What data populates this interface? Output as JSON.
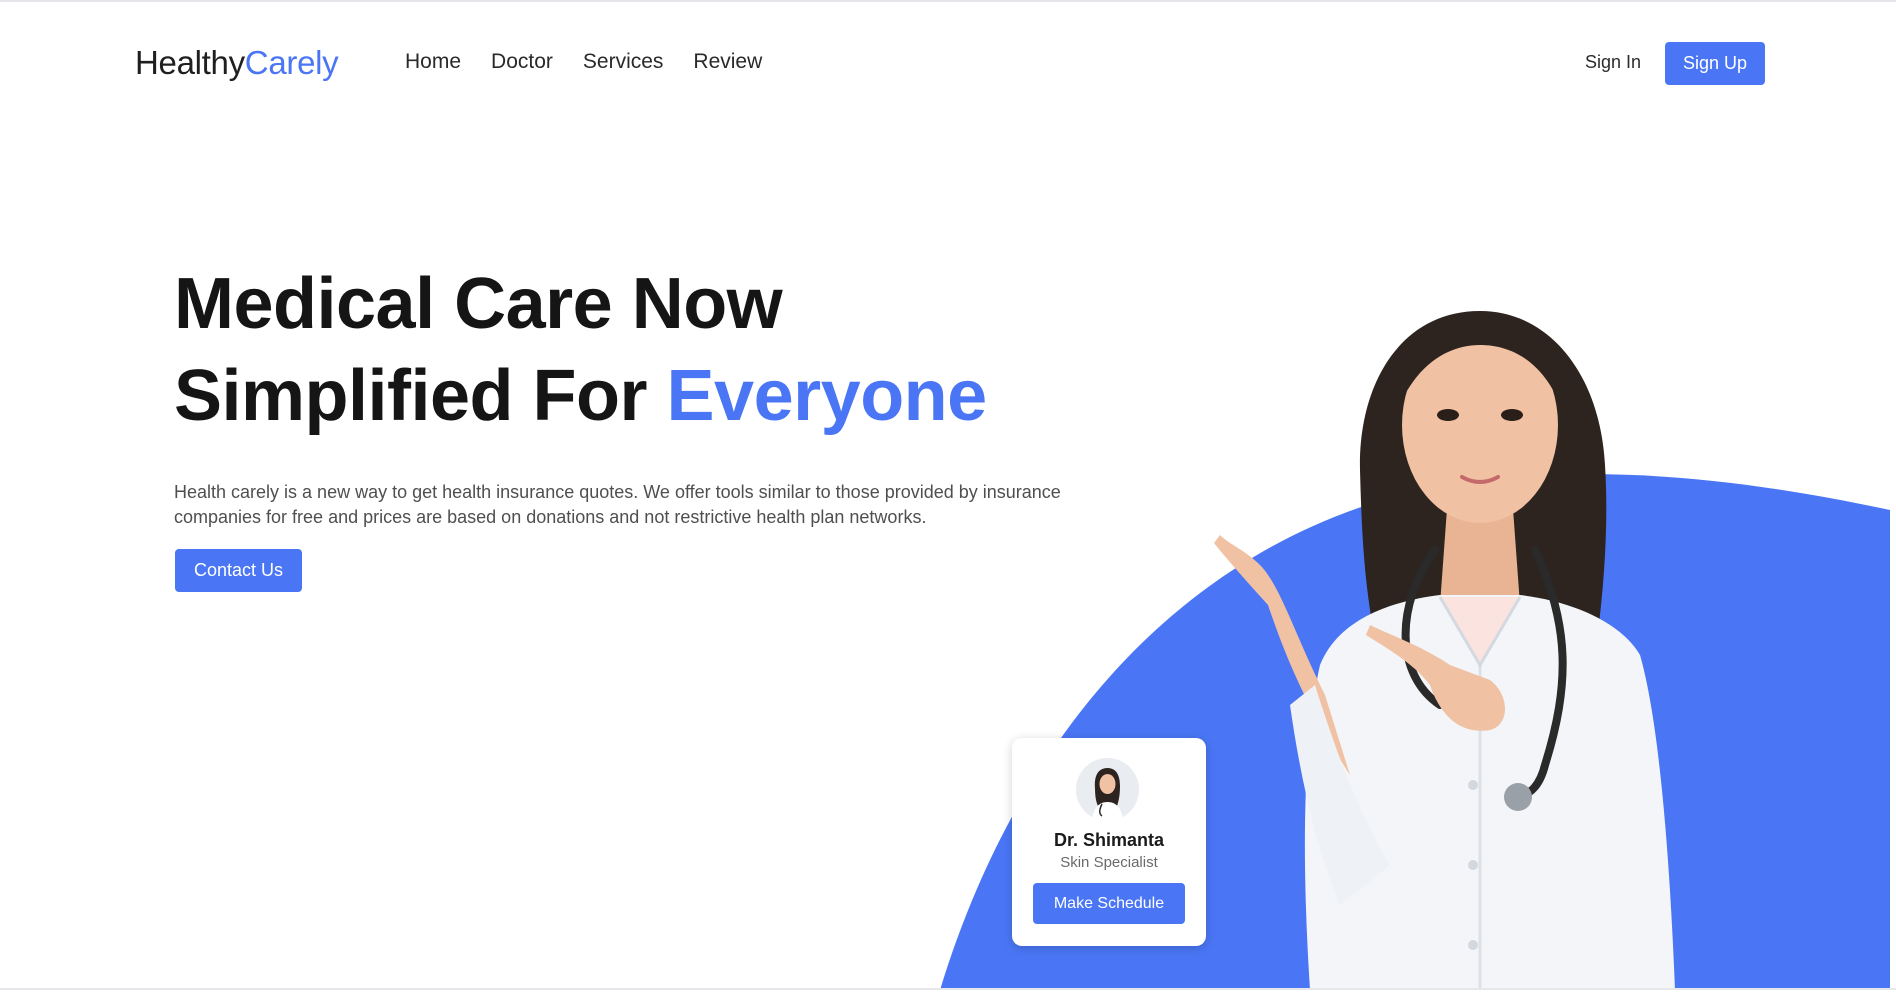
{
  "brand": {
    "name_part1": "Healthy",
    "name_part2": "Carely"
  },
  "nav": {
    "links": [
      "Home",
      "Doctor",
      "Services",
      "Review"
    ],
    "sign_in": "Sign In",
    "sign_up": "Sign Up"
  },
  "hero": {
    "title_line1": "Medical Care Now",
    "title_line2_prefix": "Simplified For ",
    "title_line2_accent": "Everyone",
    "description": "Health carely is a new way to get health insurance quotes. We offer tools similar to those provided by insurance companies for free and prices are based on donations and not restrictive health plan networks.",
    "cta": "Contact Us"
  },
  "doctor_card": {
    "name": "Dr. Shimanta",
    "specialty": "Skin Specialist",
    "button": "Make Schedule"
  },
  "colors": {
    "accent": "#4a76f5",
    "heading": "#151515",
    "body_text": "#4f4f4f"
  }
}
